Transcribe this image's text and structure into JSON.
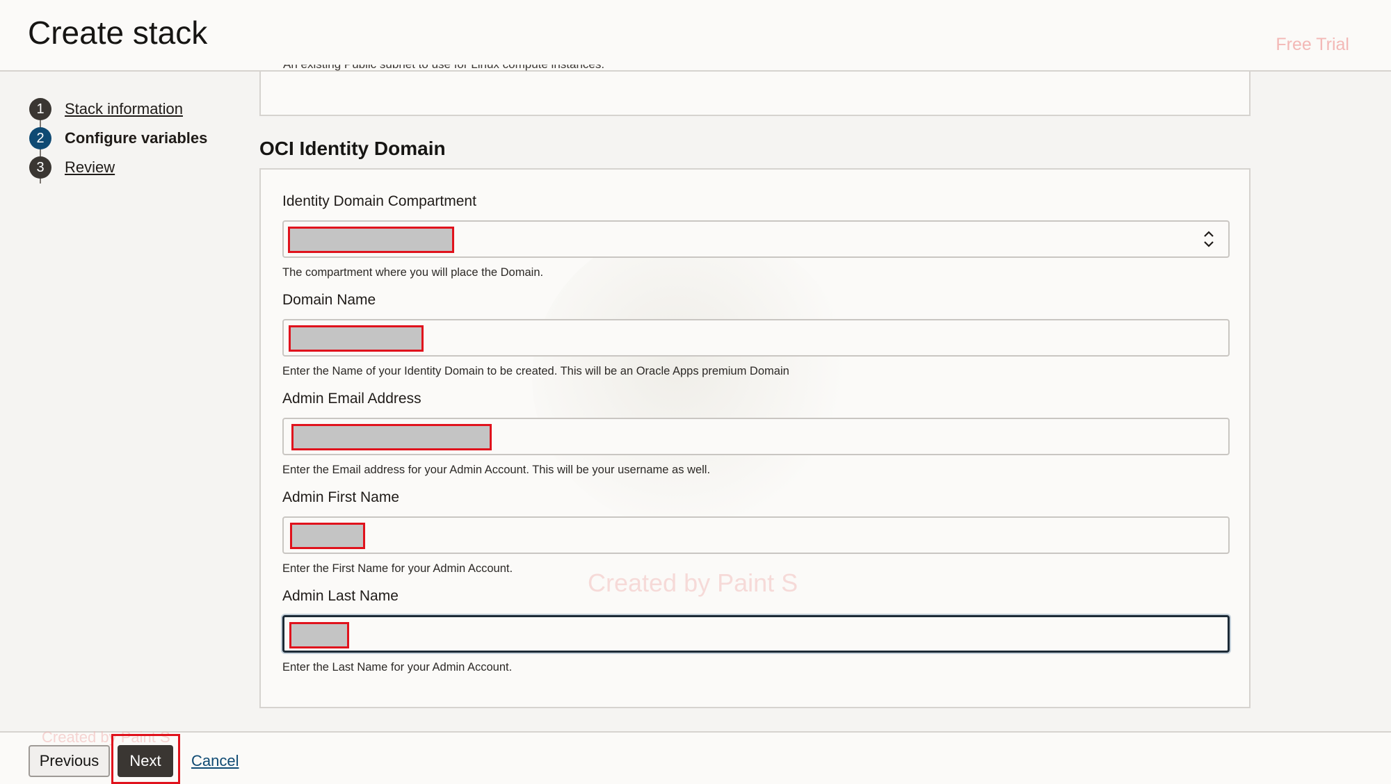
{
  "header": {
    "title": "Create stack",
    "free_trial": "Free Trial"
  },
  "steps": [
    {
      "number": "1",
      "label": "Stack information",
      "state": "done"
    },
    {
      "number": "2",
      "label": "Configure variables",
      "state": "current"
    },
    {
      "number": "3",
      "label": "Review",
      "state": "todo"
    }
  ],
  "previous_section": {
    "help_text": "An existing Public subnet to use for Linux compute instances."
  },
  "section": {
    "title": "OCI Identity Domain",
    "watermark": "Created by Paint S",
    "fields": [
      {
        "label": "Identity Domain Compartment",
        "value": "",
        "help": "The compartment where you will place the Domain.",
        "type": "select"
      },
      {
        "label": "Domain Name",
        "value": "",
        "help": "Enter the Name of your Identity Domain to be created. This will be an Oracle Apps premium Domain",
        "type": "text"
      },
      {
        "label": "Admin Email Address",
        "value": "",
        "help": "Enter the Email address for your Admin Account. This will be your username as well.",
        "type": "text"
      },
      {
        "label": "Admin First Name",
        "value": "",
        "help": "Enter the First Name for your Admin Account.",
        "type": "text"
      },
      {
        "label": "Admin Last Name",
        "value": "",
        "help": "Enter the Last Name for your Admin Account.",
        "type": "text"
      }
    ]
  },
  "footer": {
    "watermark": "Created by Paint S",
    "previous_label": "Previous",
    "next_label": "Next",
    "cancel_label": "Cancel"
  },
  "colors": {
    "accent": "#0f4a73",
    "redaction_border": "#e0121c",
    "primary_button": "#3a3632"
  },
  "icons": {
    "select_chevron": "chevron-up-down-icon"
  }
}
